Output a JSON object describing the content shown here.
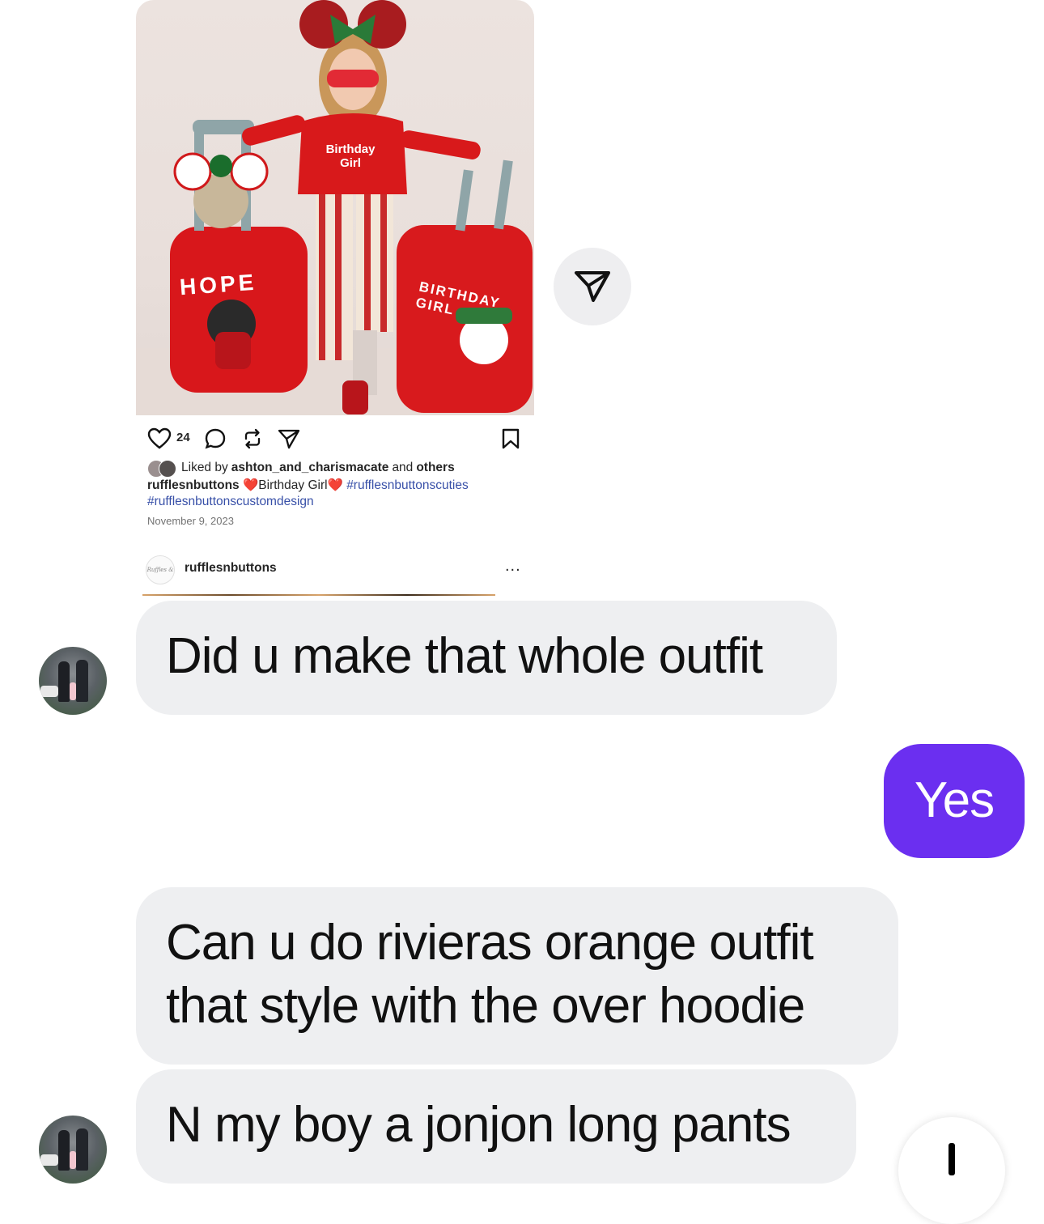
{
  "shared_post": {
    "photo_caption_text": {
      "shirt": "Birthday\nGirl",
      "left_suitcase": "HOPE",
      "right_suitcase": "BIRTHDAY GIRL"
    },
    "like_count": "24",
    "likes": {
      "prefix": "Liked by",
      "user": "ashton_and_charismacate",
      "middle": "and",
      "suffix": "others"
    },
    "caption": {
      "username": "rufflesnbuttons",
      "text": "Birthday Girl",
      "hashtag1": "#rufflesnbuttonscuties",
      "hashtag2": "#rufflesnbuttonscustomdesign"
    },
    "date": "November 9, 2023",
    "next_post": {
      "logo_text": "Ruffles & Buttons",
      "username": "rufflesnbuttons",
      "more": "..."
    }
  },
  "messages": [
    {
      "side": "incoming",
      "text": "Did u make that whole outfit"
    },
    {
      "side": "outgoing",
      "text": "Yes"
    },
    {
      "side": "incoming",
      "text": "Can u do rivieras orange outfit that style with the over hoodie"
    },
    {
      "side": "incoming",
      "text": "N my boy a jonjon long pants"
    }
  ],
  "colors": {
    "outgoing_bubble": "#6b2ff0",
    "incoming_bubble": "#eeeff1",
    "hashtag": "#3850a8",
    "share_button_bg": "#eeeef0"
  },
  "icons": {
    "share_button": "send-icon",
    "post_like": "heart-outline-icon",
    "post_comment": "comment-icon",
    "post_repost": "repost-icon",
    "post_share": "send-icon",
    "post_save": "bookmark-icon"
  }
}
